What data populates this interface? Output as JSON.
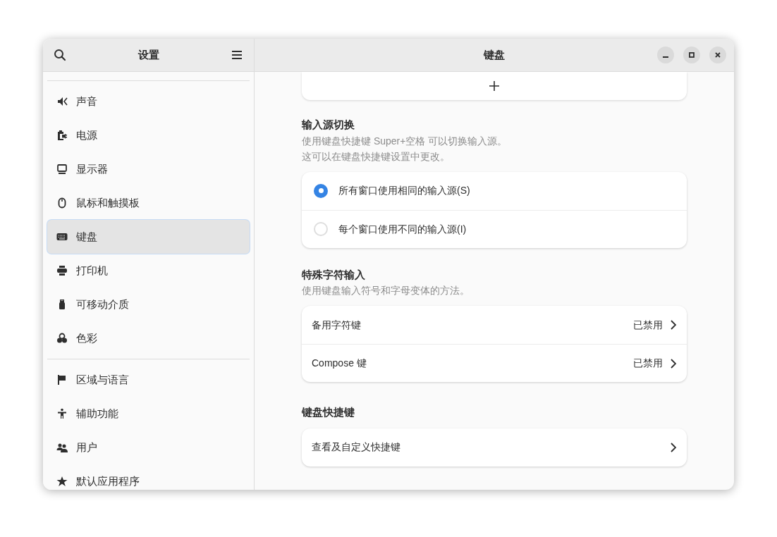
{
  "sidebar": {
    "title": "设置",
    "groups": [
      [
        {
          "label": "声音",
          "kind": "sound",
          "selected": false
        },
        {
          "label": "电源",
          "kind": "power",
          "selected": false
        },
        {
          "label": "显示器",
          "kind": "display",
          "selected": false
        },
        {
          "label": "鼠标和触摸板",
          "kind": "mouse",
          "selected": false
        },
        {
          "label": "键盘",
          "kind": "keyboard",
          "selected": true
        },
        {
          "label": "打印机",
          "kind": "printer",
          "selected": false
        },
        {
          "label": "可移动介质",
          "kind": "usb",
          "selected": false
        },
        {
          "label": "色彩",
          "kind": "color",
          "selected": false
        }
      ],
      [
        {
          "label": "区域与语言",
          "kind": "flag",
          "selected": false
        },
        {
          "label": "辅助功能",
          "kind": "accessibility",
          "selected": false
        },
        {
          "label": "用户",
          "kind": "users",
          "selected": false
        },
        {
          "label": "默认应用程序",
          "kind": "star",
          "selected": false
        }
      ]
    ]
  },
  "window": {
    "title": "键盘"
  },
  "sections": [
    {
      "kind": "radio",
      "title": "输入源切换",
      "description": [
        "使用键盘快捷键 Super+空格 可以切换输入源。",
        "这可以在键盘快捷键设置中更改。"
      ],
      "options": [
        {
          "label": "所有窗口使用相同的输入源(S)",
          "selected": true
        },
        {
          "label": "每个窗口使用不同的输入源(I)",
          "selected": false
        }
      ]
    },
    {
      "kind": "rows",
      "title": "特殊字符输入",
      "description": [
        "使用键盘输入符号和字母变体的方法。"
      ],
      "rows": [
        {
          "label": "备用字符键",
          "value": "已禁用"
        },
        {
          "label": "Compose 键",
          "value": "已禁用"
        }
      ]
    },
    {
      "kind": "rows",
      "title": "键盘快捷键",
      "rows": [
        {
          "label": "查看及自定义快捷键"
        }
      ]
    }
  ]
}
